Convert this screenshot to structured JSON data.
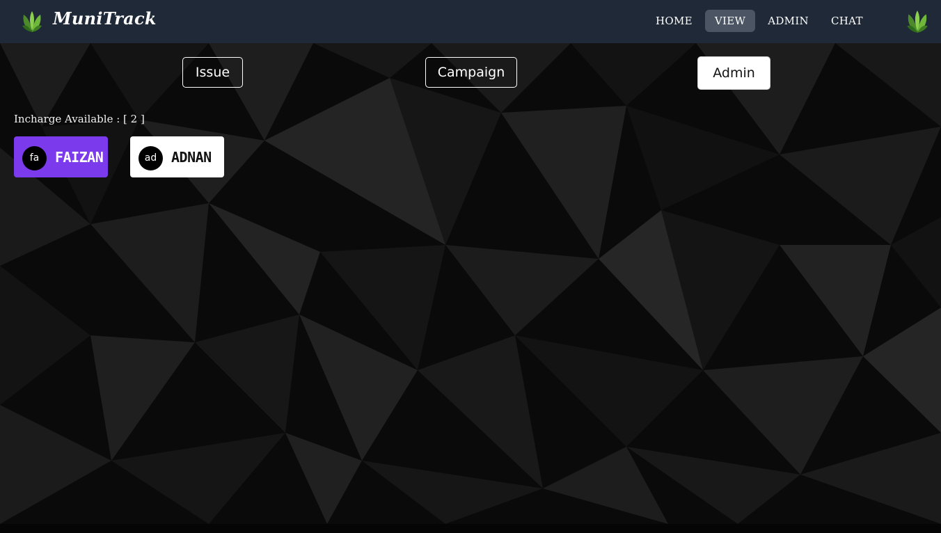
{
  "navbar": {
    "brand": "MuniTrack",
    "brand_logo_icon": "leaf-logo-icon",
    "links": [
      {
        "label": "HOME",
        "active": false
      },
      {
        "label": "VIEW",
        "active": true
      },
      {
        "label": "ADMIN",
        "active": false
      },
      {
        "label": "CHAT",
        "active": false
      }
    ],
    "profile_icon": "leaf-logo-icon"
  },
  "tabs": {
    "issue": "Issue",
    "campaign": "Campaign",
    "admin": "Admin",
    "selected": "Admin"
  },
  "incharge": {
    "available_text": "Incharge Available : [ 2 ]",
    "people": [
      {
        "initials": "fa",
        "name": "FAIZAN",
        "color": "#7c3aed"
      },
      {
        "initials": "ad",
        "name": "ADNAN",
        "color": "#ffffff"
      }
    ]
  },
  "colors": {
    "navbar_bg": "#1f2937",
    "active_nav_bg": "#4b5563",
    "accent_purple": "#7c3aed"
  }
}
